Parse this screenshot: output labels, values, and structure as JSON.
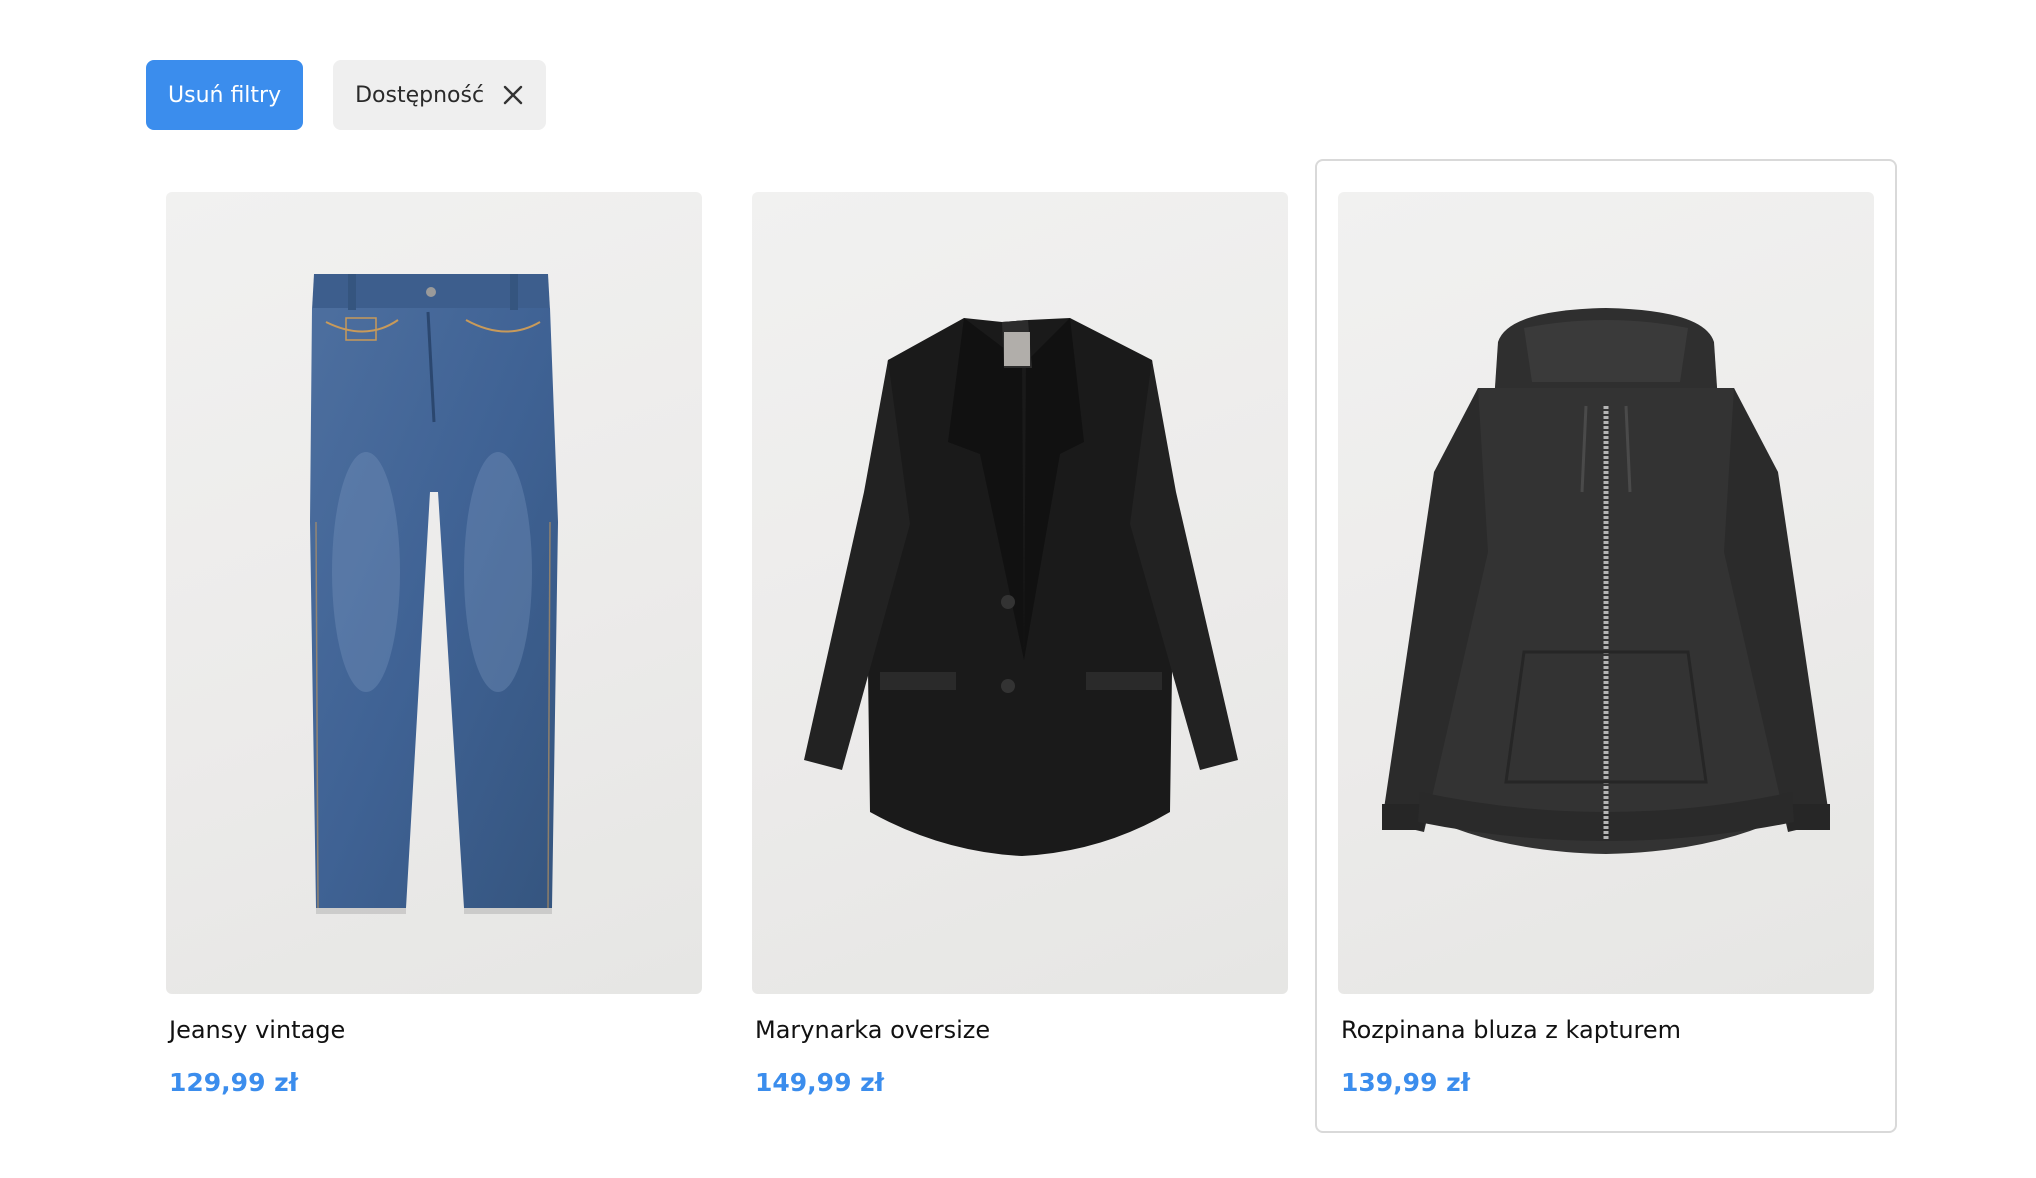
{
  "filters": {
    "clear_label": "Usuń filtry",
    "active": [
      {
        "label": "Dostępność",
        "remove_icon": "close-icon"
      }
    ]
  },
  "products": [
    {
      "name": "Jeansy vintage",
      "price": "129,99 zł",
      "image": "jeans-image"
    },
    {
      "name": "Marynarka oversize",
      "price": "149,99 zł",
      "image": "blazer-image"
    },
    {
      "name": "Rozpinana bluza z kapturem",
      "price": "139,99 zł",
      "image": "hoodie-image"
    }
  ],
  "colors": {
    "accent": "#3b8ded",
    "chip_bg": "#efefef",
    "image_bg": "#ecebea"
  }
}
